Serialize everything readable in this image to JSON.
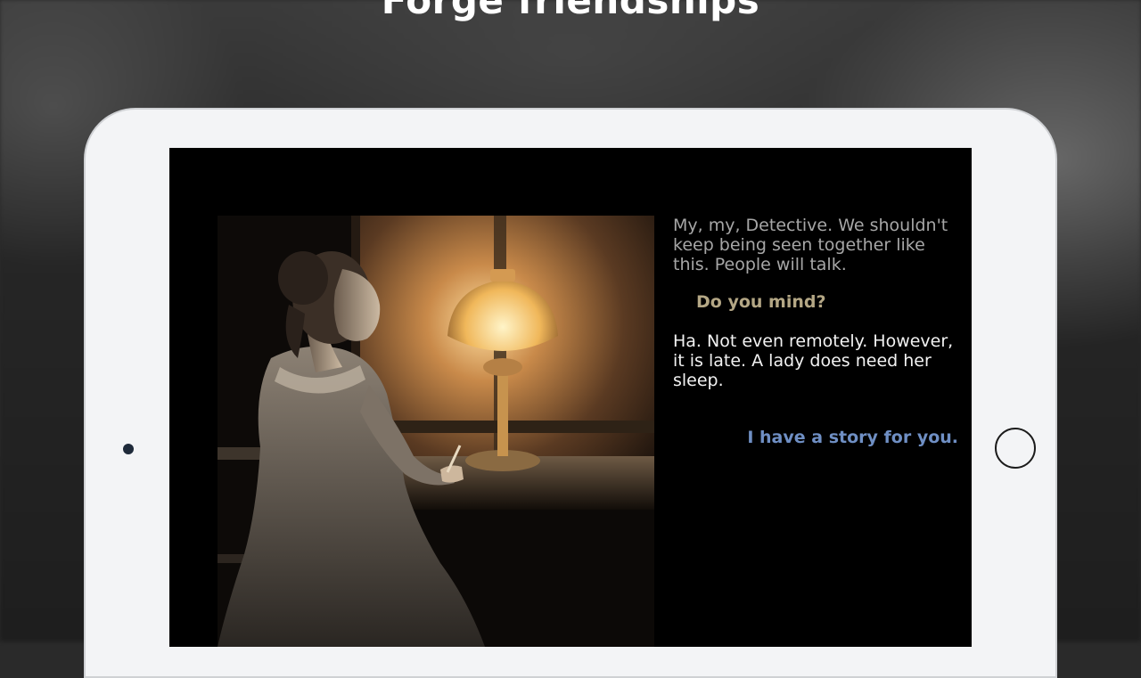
{
  "headline": "Forge friendships",
  "dialogue": {
    "npc_line_1": "My, my, Detective. We shouldn't keep being seen together like this. People will talk.",
    "player_choice_made": "Do you mind?",
    "npc_line_2": "Ha. Not even remotely. However, it is late. A lady does need her sleep.",
    "player_choice_option": "I have a story for you."
  },
  "colors": {
    "past_choice": "#b4a785",
    "option_choice": "#6f8fc4",
    "faded_text": "#a6a6a6",
    "bright_text": "#f2f2f2"
  },
  "icons": {
    "home": "home-button-icon",
    "camera": "front-camera-icon"
  }
}
